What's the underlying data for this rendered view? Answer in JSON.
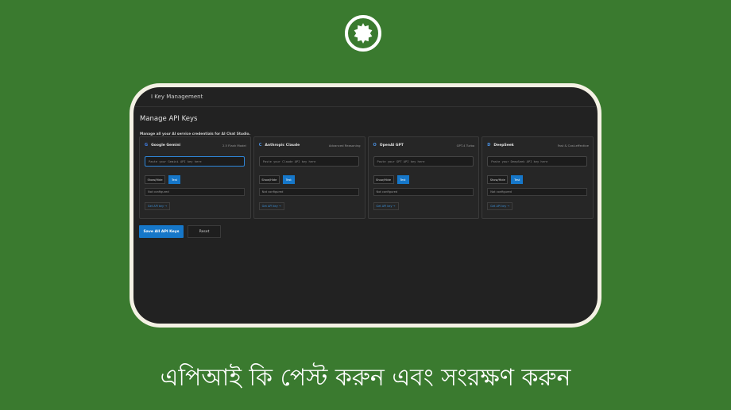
{
  "logo": {
    "icon": "gear-badge-icon"
  },
  "app": {
    "header_title": "I Key Management",
    "page_title": "Manage API Keys",
    "subtitle": "Manage all your AI service credentials for AI Chat Studio.",
    "providers": [
      {
        "letter": "G",
        "name": "Google Gemini",
        "tag": "2.5 Flash Model",
        "placeholder": "Paste your Gemini API key here",
        "show_label": "Show/Hide",
        "test_label": "Test",
        "status": "Not configured",
        "get_key_label": "Get API key →",
        "letter_color": "#4285f4"
      },
      {
        "letter": "C",
        "name": "Anthropic Claude",
        "tag": "Advanced Reasoning",
        "placeholder": "Paste your Claude API key here",
        "show_label": "Show/Hide",
        "test_label": "Test",
        "status": "Not configured",
        "get_key_label": "Get API key →",
        "letter_color": "#4a90e2"
      },
      {
        "letter": "O",
        "name": "OpenAI GPT",
        "tag": "GPT-4 Turbo",
        "placeholder": "Paste your GPT API key here",
        "show_label": "Show/Hide",
        "test_label": "Test",
        "status": "Not configured",
        "get_key_label": "Get API key →",
        "letter_color": "#4a90e2"
      },
      {
        "letter": "D",
        "name": "DeepSeek",
        "tag": "Fast & Cost-effective",
        "placeholder": "Paste your DeepSeek API key here",
        "show_label": "Show/Hide",
        "test_label": "Test",
        "status": "Not configured",
        "get_key_label": "Get API key →",
        "letter_color": "#4a90e2"
      }
    ],
    "save_label": "Save All API Keys",
    "reset_label": "Reset"
  },
  "caption": "এপিআই কি পেস্ট করুন এবং সংরক্ষণ করুন",
  "colors": {
    "background": "#3a7a2f",
    "frame": "#f4f1e4",
    "screen": "#222222",
    "accent": "#1677c9"
  }
}
